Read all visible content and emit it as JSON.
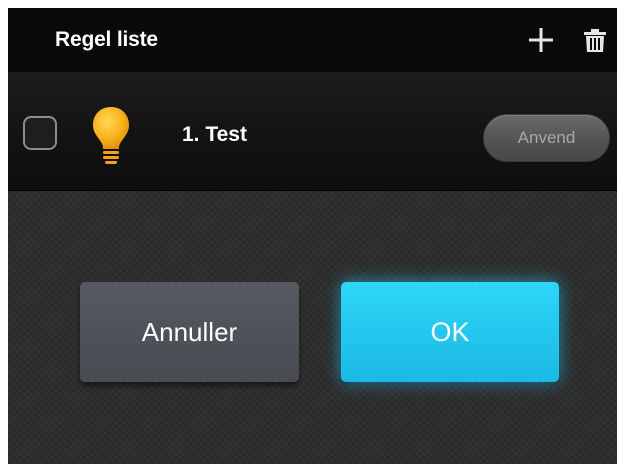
{
  "header": {
    "title": "Regel liste",
    "add_icon": "plus-icon",
    "delete_icon": "trash-icon"
  },
  "rules": [
    {
      "name": "1. Test",
      "checked": false,
      "icon": "lightbulb-icon",
      "apply_label": "Anvend"
    }
  ],
  "dialog": {
    "cancel_label": "Annuller",
    "ok_label": "OK"
  },
  "colors": {
    "header_bg": "#0a0a0a",
    "ok_accent": "#1ec4ee",
    "bulb": "#f6b21a"
  }
}
